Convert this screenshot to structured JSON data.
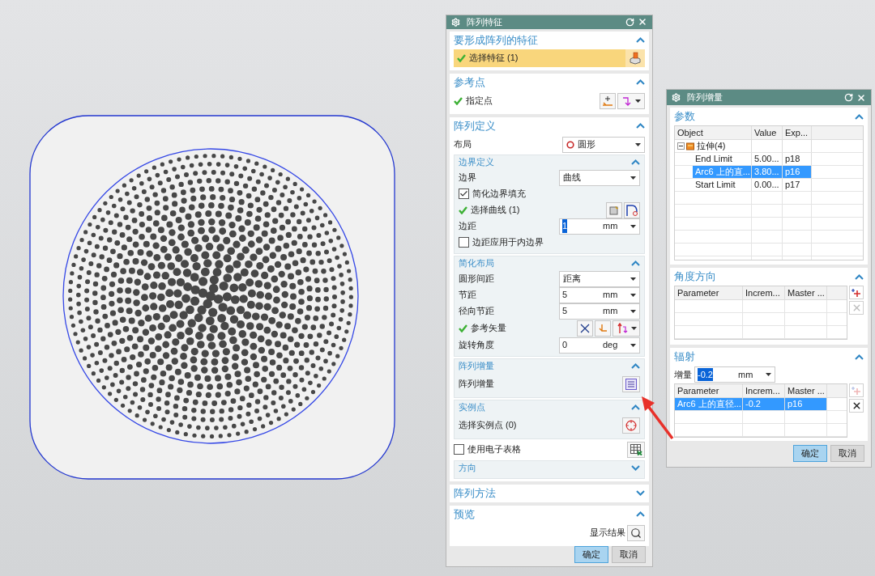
{
  "feature_dialog": {
    "title": "阵列特征",
    "features_section": {
      "title": "要形成阵列的特征",
      "expanded": true,
      "select_row": {
        "label": "选择特征 (1)",
        "done": true,
        "selected": true
      }
    },
    "reference_point": {
      "title": "参考点",
      "expanded": true,
      "row": {
        "label": "指定点",
        "done": true
      }
    },
    "definition": {
      "title": "阵列定义",
      "expanded": true,
      "layout": {
        "label": "布局",
        "value": "圆形"
      },
      "boundary": {
        "title": "边界定义",
        "expanded": true,
        "boundary_type": {
          "label": "边界",
          "value": "曲线"
        },
        "simplify_fill": {
          "label": "简化边界填充",
          "checked": true
        },
        "select_curve": {
          "label": "选择曲线 (1)",
          "done": true
        },
        "margin": {
          "label": "边距",
          "value": "1",
          "unit": "mm",
          "highlighted": true
        },
        "apply_inner": {
          "label": "边距应用于内边界",
          "checked": false
        }
      },
      "simplified_layout": {
        "title": "简化布局",
        "expanded": true,
        "spacing": {
          "label": "圆形间距",
          "value": "距离"
        },
        "pitch": {
          "label": "节距",
          "value": "5",
          "unit": "mm"
        },
        "radial_pitch": {
          "label": "径向节距",
          "value": "5",
          "unit": "mm"
        },
        "ref_vector": {
          "label": "参考矢量",
          "done": true
        },
        "rotation": {
          "label": "旋转角度",
          "value": "0",
          "unit": "deg"
        }
      },
      "increment": {
        "title": "阵列增量",
        "expanded": true,
        "label": "阵列增量"
      },
      "instance_points": {
        "title": "实例点",
        "expanded": true,
        "label": "选择实例点 (0)"
      },
      "spreadsheet": {
        "label": "使用电子表格",
        "checked": false
      },
      "direction": {
        "title": "方向",
        "expanded": false
      }
    },
    "method": {
      "title": "阵列方法",
      "expanded": false
    },
    "preview": {
      "title": "预览",
      "expanded": true,
      "label": "显示结果"
    },
    "buttons": [
      {
        "label": "确定",
        "default": true
      },
      {
        "label": "取消",
        "default": false
      }
    ]
  },
  "increment_dialog": {
    "title": "阵列增量",
    "parameters": {
      "title": "参数",
      "expanded": true,
      "columns": [
        "Object",
        "Value",
        "Exp..."
      ],
      "tree": [
        {
          "label": "拉伸(4)",
          "expanded": true,
          "children": [
            {
              "cells": [
                "End Limit",
                "5.00...",
                "p18"
              ],
              "selected": false
            },
            {
              "cells": [
                "Arc6 上的直...",
                "3.80...",
                "p16"
              ],
              "selected": true
            },
            {
              "cells": [
                "Start Limit",
                "0.00...",
                "p17"
              ],
              "selected": false
            }
          ]
        }
      ]
    },
    "angular": {
      "title": "角度方向",
      "expanded": true,
      "columns": [
        "Parameter",
        "Increm...",
        "Master ..."
      ],
      "add_enabled": true,
      "delete_enabled": false
    },
    "radial": {
      "title": "辐射",
      "expanded": true,
      "increment": {
        "label": "增量",
        "value": "-0.2",
        "unit": "mm",
        "highlighted": true
      },
      "columns": [
        "Parameter",
        "Increm...",
        "Master ..."
      ],
      "rows": [
        {
          "cells": [
            "Arc6 上的直径...",
            "-0.2",
            "p16"
          ],
          "selected": true
        }
      ],
      "add_enabled": false,
      "delete_enabled": true
    },
    "buttons": [
      {
        "label": "确定",
        "default": true
      },
      {
        "label": "取消",
        "default": false
      }
    ]
  }
}
